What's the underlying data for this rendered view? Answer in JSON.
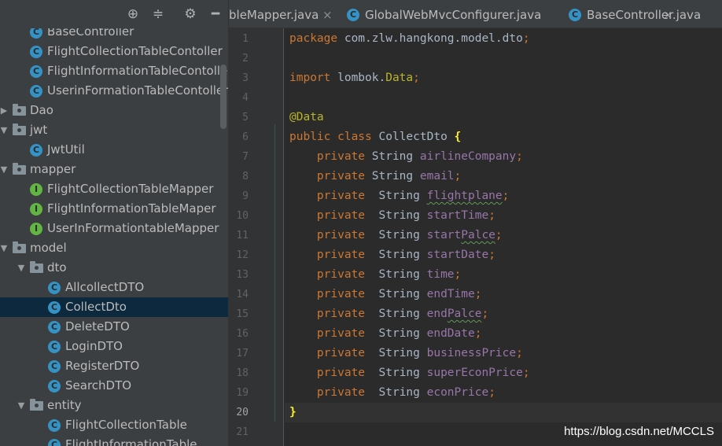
{
  "toolbar": {
    "icons": [
      "crosshair-icon",
      "collapse-all-icon",
      "gear-icon",
      "hide-icon"
    ]
  },
  "tree": [
    {
      "label": "BaseController",
      "icon": "class",
      "indent": 1,
      "arrow": ""
    },
    {
      "label": "FlightCollectionTableContoller",
      "icon": "class",
      "indent": 1,
      "arrow": ""
    },
    {
      "label": "FlightInformationTableContoller",
      "icon": "class",
      "indent": 1,
      "arrow": ""
    },
    {
      "label": "UserinFormationTableContoller",
      "icon": "class",
      "indent": 1,
      "arrow": ""
    },
    {
      "label": "Dao",
      "icon": "folder",
      "indent": 0,
      "arrow": "collapsed"
    },
    {
      "label": "jwt",
      "icon": "folder",
      "indent": 0,
      "arrow": "expanded"
    },
    {
      "label": "JwtUtil",
      "icon": "class",
      "indent": 1,
      "arrow": ""
    },
    {
      "label": "mapper",
      "icon": "folder",
      "indent": 0,
      "arrow": "expanded"
    },
    {
      "label": "FlightCollectionTableMapper",
      "icon": "interface",
      "indent": 1,
      "arrow": ""
    },
    {
      "label": "FlightInformationTableMaper",
      "icon": "interface",
      "indent": 1,
      "arrow": ""
    },
    {
      "label": "UserInFormationtableMapper",
      "icon": "interface",
      "indent": 1,
      "arrow": ""
    },
    {
      "label": "model",
      "icon": "folder",
      "indent": 0,
      "arrow": "expanded"
    },
    {
      "label": "dto",
      "icon": "folder",
      "indent": 1,
      "arrow": "expanded"
    },
    {
      "label": "AllcollectDTO",
      "icon": "class",
      "indent": 2,
      "arrow": ""
    },
    {
      "label": "CollectDto",
      "icon": "class",
      "indent": 2,
      "arrow": "",
      "selected": true
    },
    {
      "label": "DeleteDTO",
      "icon": "class",
      "indent": 2,
      "arrow": ""
    },
    {
      "label": "LoginDTO",
      "icon": "class",
      "indent": 2,
      "arrow": ""
    },
    {
      "label": "RegisterDTO",
      "icon": "class",
      "indent": 2,
      "arrow": ""
    },
    {
      "label": "SearchDTO",
      "icon": "class",
      "indent": 2,
      "arrow": ""
    },
    {
      "label": "entity",
      "icon": "folder",
      "indent": 1,
      "arrow": "expanded"
    },
    {
      "label": "FlightCollectionTable",
      "icon": "class",
      "indent": 2,
      "arrow": ""
    },
    {
      "label": "FlightInformationTable",
      "icon": "class",
      "indent": 2,
      "arrow": ""
    }
  ],
  "tabs": [
    {
      "label": "bleMapper.java",
      "close": "×",
      "icon": false
    },
    {
      "label": "GlobalWebMvcConfigurer.java",
      "close": "×",
      "icon": true
    },
    {
      "label": "BaseController.java",
      "close": "×",
      "icon": true
    }
  ],
  "editor": {
    "current_line": 20,
    "lines": [
      [
        [
          "kw",
          "package "
        ],
        [
          "t",
          "com.zlw.hangkong.model.dto"
        ],
        [
          "kw",
          ";"
        ]
      ],
      [],
      [
        [
          "kw",
          "import "
        ],
        [
          "t",
          "lombok."
        ],
        [
          "ann",
          "Data"
        ],
        [
          "kw",
          ";"
        ]
      ],
      [],
      [
        [
          "ann",
          "@Data"
        ]
      ],
      [
        [
          "kw",
          "public class "
        ],
        [
          "t",
          "CollectDto "
        ],
        [
          "brace",
          "{"
        ]
      ],
      [
        [
          "t",
          "    "
        ],
        [
          "kw",
          "private "
        ],
        [
          "t",
          "String "
        ],
        [
          "fld",
          "airlineCompany"
        ],
        [
          "kw",
          ";"
        ]
      ],
      [
        [
          "t",
          "    "
        ],
        [
          "kw",
          "private "
        ],
        [
          "t",
          "String "
        ],
        [
          "fld",
          "email"
        ],
        [
          "kw",
          ";"
        ]
      ],
      [
        [
          "t",
          "    "
        ],
        [
          "kw",
          "private  "
        ],
        [
          "t",
          "String "
        ],
        [
          "fldtypo",
          "flightplane"
        ],
        [
          "kw",
          ";"
        ]
      ],
      [
        [
          "t",
          "    "
        ],
        [
          "kw",
          "private  "
        ],
        [
          "t",
          "String "
        ],
        [
          "fld",
          "startTime"
        ],
        [
          "kw",
          ";"
        ]
      ],
      [
        [
          "t",
          "    "
        ],
        [
          "kw",
          "private  "
        ],
        [
          "t",
          "String "
        ],
        [
          "fld",
          "start"
        ],
        [
          "fldtypo",
          "Palce"
        ],
        [
          "kw",
          ";"
        ]
      ],
      [
        [
          "t",
          "    "
        ],
        [
          "kw",
          "private  "
        ],
        [
          "t",
          "String "
        ],
        [
          "fld",
          "startDate"
        ],
        [
          "kw",
          ";"
        ]
      ],
      [
        [
          "t",
          "    "
        ],
        [
          "kw",
          "private  "
        ],
        [
          "t",
          "String "
        ],
        [
          "fld",
          "time"
        ],
        [
          "kw",
          ";"
        ]
      ],
      [
        [
          "t",
          "    "
        ],
        [
          "kw",
          "private  "
        ],
        [
          "t",
          "String "
        ],
        [
          "fld",
          "endTime"
        ],
        [
          "kw",
          ";"
        ]
      ],
      [
        [
          "t",
          "    "
        ],
        [
          "kw",
          "private  "
        ],
        [
          "t",
          "String "
        ],
        [
          "fld",
          "end"
        ],
        [
          "fldtypo",
          "Palce"
        ],
        [
          "kw",
          ";"
        ]
      ],
      [
        [
          "t",
          "    "
        ],
        [
          "kw",
          "private  "
        ],
        [
          "t",
          "String "
        ],
        [
          "fld",
          "endDate"
        ],
        [
          "kw",
          ";"
        ]
      ],
      [
        [
          "t",
          "    "
        ],
        [
          "kw",
          "private  "
        ],
        [
          "t",
          "String "
        ],
        [
          "fld",
          "businessPrice"
        ],
        [
          "kw",
          ";"
        ]
      ],
      [
        [
          "t",
          "    "
        ],
        [
          "kw",
          "private  "
        ],
        [
          "t",
          "String "
        ],
        [
          "fld",
          "superEconPrice"
        ],
        [
          "kw",
          ";"
        ]
      ],
      [
        [
          "t",
          "    "
        ],
        [
          "kw",
          "private  "
        ],
        [
          "t",
          "String "
        ],
        [
          "fld",
          "econPrice"
        ],
        [
          "kw",
          ";"
        ]
      ],
      [
        [
          "brace",
          "}"
        ]
      ],
      []
    ]
  },
  "watermark": "https://blog.csdn.net/MCCLS",
  "colors": {
    "keyword": "#cc7832",
    "annotation": "#bbb529",
    "field": "#9876aa",
    "text": "#a9b7c6",
    "class_icon": "#3592c4",
    "interface_icon": "#62b543",
    "selection": "#0d293e"
  }
}
